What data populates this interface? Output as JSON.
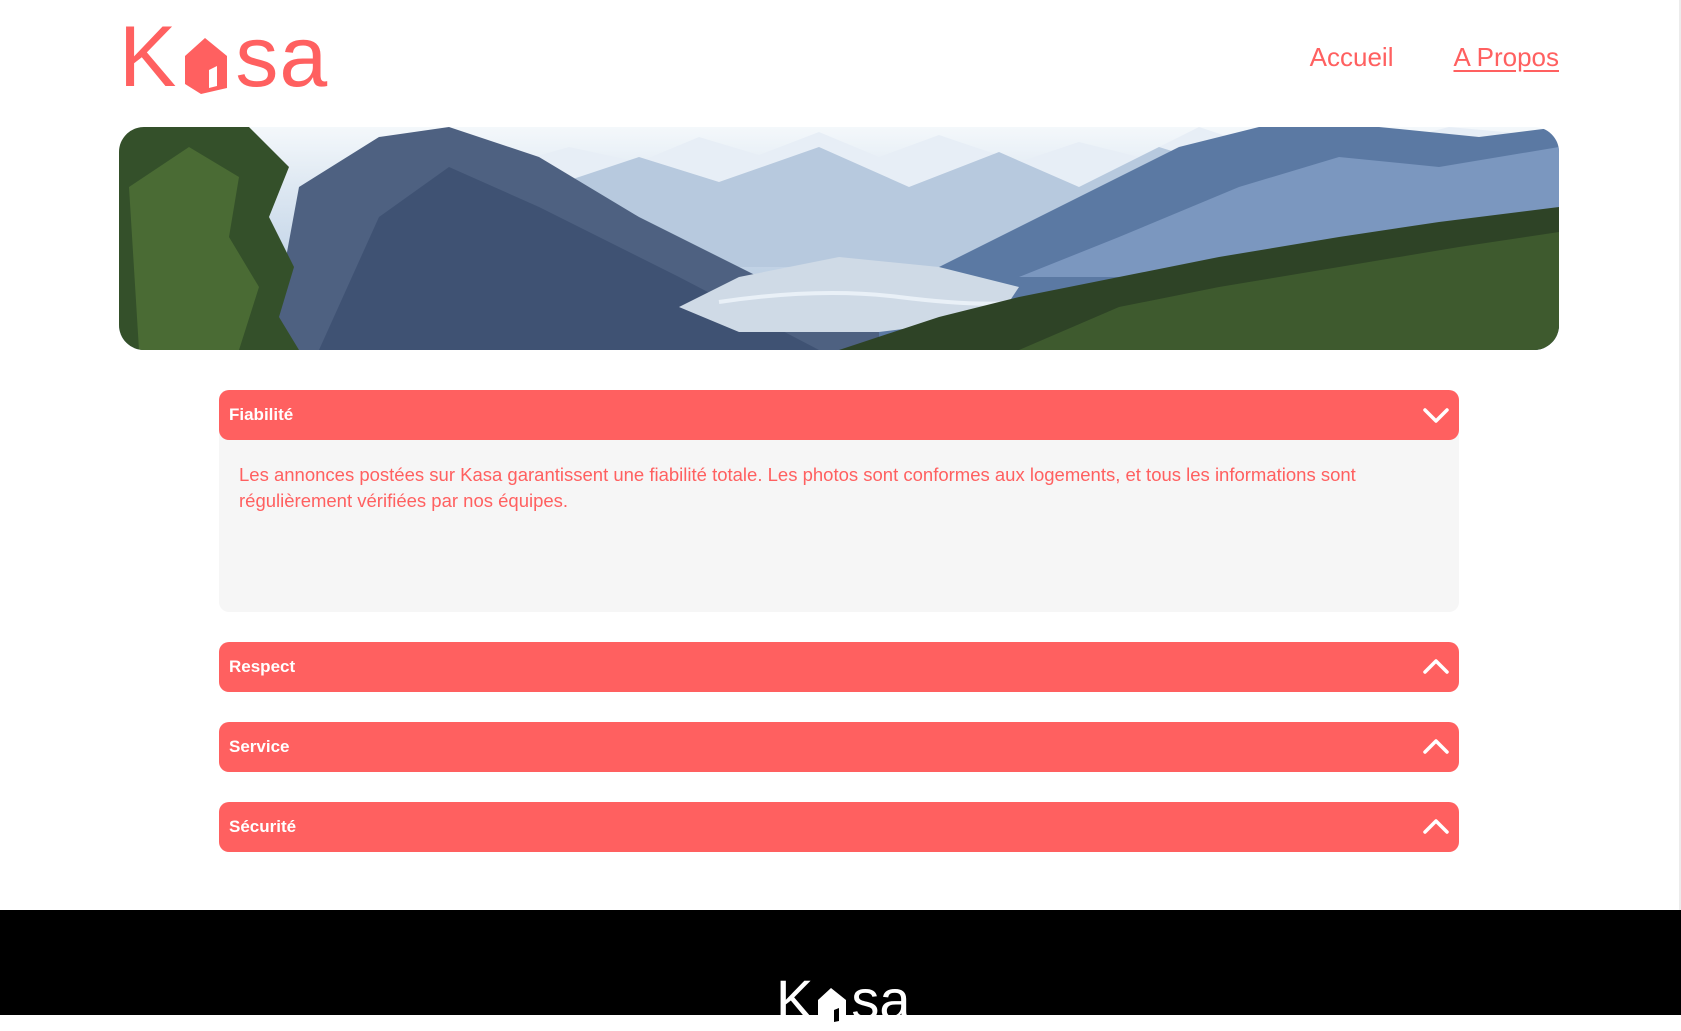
{
  "logo": {
    "letter_k": "K",
    "letters_rest": "sa"
  },
  "nav": {
    "items": [
      {
        "label": "Accueil",
        "active": false
      },
      {
        "label": "A Propos",
        "active": true
      }
    ]
  },
  "collapses": [
    {
      "title": "Fiabilité",
      "open": true,
      "text": "Les annonces postées sur Kasa garantissent une fiabilité totale. Les photos sont conformes aux logements, et tous les informations sont régulièrement vérifiées par nos équipes."
    },
    {
      "title": "Respect",
      "open": false
    },
    {
      "title": "Service",
      "open": false
    },
    {
      "title": "Sécurité",
      "open": false
    }
  ],
  "footer": {
    "logo_letter_k": "K",
    "logo_letters_rest": "sa"
  },
  "colors": {
    "brand": "#ff6060",
    "panel": "#f6f6f6",
    "footer_bg": "#000000"
  },
  "icons": {
    "collapse_open": "chevron-down-icon",
    "collapse_closed": "chevron-up-icon",
    "logo_mark": "house-icon"
  }
}
